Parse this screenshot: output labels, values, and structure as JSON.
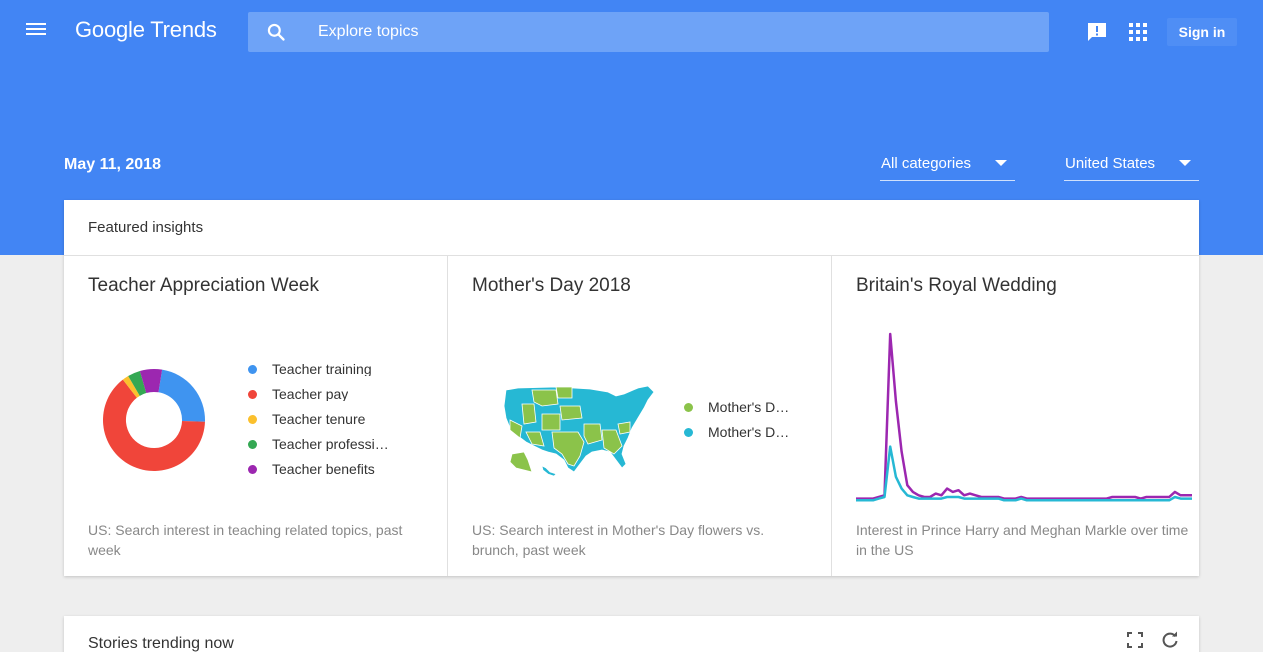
{
  "header": {
    "logo": "Google Trends",
    "search_placeholder": "Explore topics",
    "sign_in_label": "Sign in",
    "icons": [
      "menu-icon",
      "search-icon",
      "feedback-icon",
      "apps-icon"
    ]
  },
  "filters": {
    "date": "May 11, 2018",
    "category": "All categories",
    "geo": "United States"
  },
  "featured": {
    "title": "Featured insights",
    "cards": [
      {
        "title": "Teacher Appreciation Week",
        "caption": "US: Search interest in teaching related topics, past week",
        "legend": [
          {
            "label": "Teacher training",
            "color": "#3f94f0"
          },
          {
            "label": "Teacher pay",
            "color": "#f0453a"
          },
          {
            "label": "Teacher tenure",
            "color": "#fbc02d"
          },
          {
            "label": "Teacher professio…",
            "color": "#34a853"
          },
          {
            "label": "Teacher benefits",
            "color": "#9c27b0"
          }
        ]
      },
      {
        "title": "Mother's Day 2018",
        "caption": "US: Search interest in Mother's Day flowers vs. brunch, past week",
        "legend": [
          {
            "label": "Mother's Day flowers",
            "color": "#8bc34a"
          },
          {
            "label": "Mother's Day brunch",
            "color": "#26b8d4"
          }
        ]
      },
      {
        "title": "Britain's Royal Wedding",
        "caption": "Interest in Prince Harry and Meghan Markle over time in the US"
      }
    ]
  },
  "chart_data": [
    {
      "type": "pie",
      "title": "Teacher Appreciation Week",
      "categories": [
        "Teacher training",
        "Teacher pay",
        "Teacher tenure",
        "Teacher professio…",
        "Teacher benefits"
      ],
      "values": [
        23,
        64,
        2,
        4,
        7
      ],
      "colors": [
        "#3f94f0",
        "#f0453a",
        "#fbc02d",
        "#34a853",
        "#9c27b0"
      ],
      "hole": 0.55
    },
    {
      "type": "line",
      "title": "Britain's Royal Wedding",
      "x": [
        0,
        1,
        2,
        3,
        4,
        5,
        6,
        7,
        8,
        9,
        10,
        11,
        12,
        13,
        14,
        15,
        16,
        17,
        18,
        19,
        20,
        21,
        22,
        23,
        24,
        25,
        26,
        27,
        28,
        29,
        30,
        31,
        32,
        33,
        34,
        35,
        36,
        37,
        38,
        39,
        40,
        41,
        42,
        43,
        44,
        45,
        46,
        47,
        48,
        49,
        50,
        51,
        52,
        53,
        54,
        55,
        56,
        57,
        58,
        59
      ],
      "series": [
        {
          "color": "#9c27b0",
          "values": [
            2,
            2,
            2,
            2,
            3,
            4,
            100,
            60,
            30,
            10,
            6,
            4,
            3,
            3,
            5,
            4,
            8,
            6,
            7,
            4,
            5,
            4,
            3,
            3,
            3,
            3,
            2,
            2,
            2,
            3,
            2,
            2,
            2,
            2,
            2,
            2,
            2,
            2,
            2,
            2,
            2,
            2,
            2,
            2,
            2,
            3,
            3,
            3,
            3,
            3,
            2,
            3,
            3,
            3,
            3,
            3,
            6,
            4,
            4,
            4
          ]
        },
        {
          "color": "#26b8d4",
          "values": [
            1,
            1,
            1,
            1,
            2,
            3,
            33,
            15,
            8,
            4,
            3,
            2,
            2,
            2,
            2,
            2,
            3,
            3,
            3,
            2,
            2,
            2,
            2,
            2,
            2,
            2,
            1,
            1,
            1,
            2,
            1,
            1,
            1,
            1,
            1,
            1,
            1,
            1,
            1,
            1,
            1,
            1,
            1,
            1,
            1,
            1,
            1,
            1,
            1,
            1,
            1,
            1,
            1,
            1,
            1,
            1,
            3,
            2,
            2,
            2
          ]
        }
      ],
      "ylim": [
        0,
        100
      ]
    }
  ],
  "stories": {
    "title": "Stories trending now"
  }
}
